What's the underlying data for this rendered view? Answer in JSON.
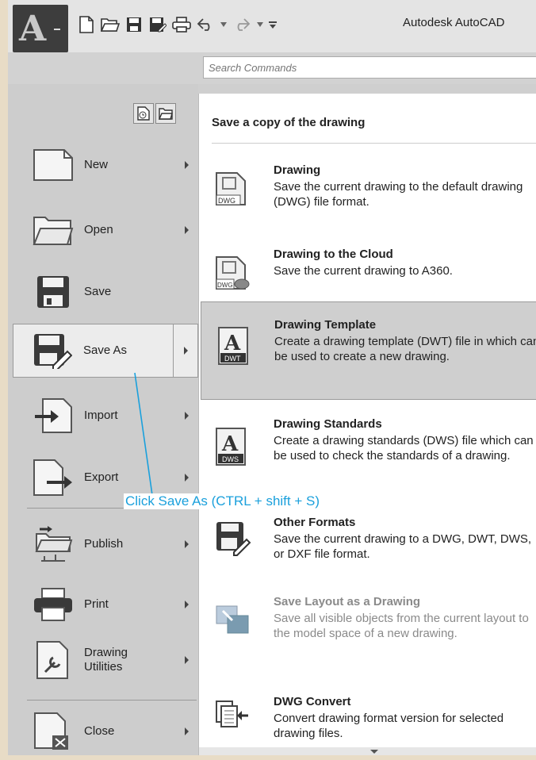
{
  "titlebar": {
    "app_title": "Autodesk AutoCAD",
    "app_logo": "A",
    "quick_access": [
      "new-icon",
      "open-icon",
      "save-icon",
      "save-as-icon",
      "print-icon",
      "undo-icon",
      "redo-icon",
      "customize-icon"
    ]
  },
  "search": {
    "placeholder": "Search Commands"
  },
  "menu": {
    "items": [
      {
        "label": "New"
      },
      {
        "label": "Open"
      },
      {
        "label": "Save"
      },
      {
        "label": "Save As"
      },
      {
        "label": "Import"
      },
      {
        "label": "Export"
      },
      {
        "label": "Publish"
      },
      {
        "label": "Print"
      },
      {
        "label": "Drawing Utilities"
      },
      {
        "label": "Close"
      }
    ],
    "selected": "Save As"
  },
  "submenu": {
    "heading": "Save a copy of the drawing",
    "items": [
      {
        "title": "Drawing",
        "desc": "Save the current drawing to the default drawing (DWG) file format.",
        "icon_text": "DWG"
      },
      {
        "title": "Drawing to the Cloud",
        "desc": "Save the current drawing to A360.",
        "icon_text": "DWG"
      },
      {
        "title": "Drawing Template",
        "desc": "Create a drawing template (DWT) file in which can be used to create a new drawing.",
        "icon_text": "DWT"
      },
      {
        "title": "Drawing Standards",
        "desc": "Create a drawing standards (DWS) file which can be used to check the standards of a drawing.",
        "icon_text": "DWS"
      },
      {
        "title": "Other Formats",
        "desc": "Save the current drawing to a DWG, DWT, DWS, or DXF file format."
      },
      {
        "title": "Save Layout as a Drawing",
        "desc": "Save all visible objects from the current layout to the model space of a new drawing."
      },
      {
        "title": "DWG Convert",
        "desc": "Convert drawing format version for selected drawing files."
      }
    ]
  },
  "callout": {
    "text": "Click Save As (CTRL + shift + S)"
  },
  "colors": {
    "callout": "#1aa0dc",
    "app_button": "#3d3d3d",
    "highlight": "#cfcfcf"
  }
}
